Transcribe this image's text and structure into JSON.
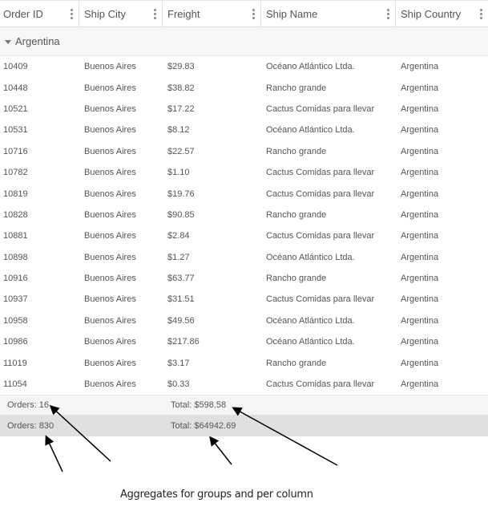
{
  "grid": {
    "columns": [
      {
        "label": "Order ID",
        "menu_icon": "more-vertical-icon"
      },
      {
        "label": "Ship City",
        "menu_icon": "more-vertical-icon"
      },
      {
        "label": "Freight",
        "menu_icon": "more-vertical-icon"
      },
      {
        "label": "Ship Name",
        "menu_icon": "more-vertical-icon"
      },
      {
        "label": "Ship Country",
        "menu_icon": "more-vertical-icon"
      }
    ],
    "group": {
      "label": "Argentina",
      "expand_icon": "caret-down-icon",
      "expanded": true
    },
    "rows": [
      {
        "order_id": "10409",
        "ship_city": "Buenos Aires",
        "freight": "$29.83",
        "ship_name": "Océano Atlántico Ltda.",
        "ship_country": "Argentina"
      },
      {
        "order_id": "10448",
        "ship_city": "Buenos Aires",
        "freight": "$38.82",
        "ship_name": "Rancho grande",
        "ship_country": "Argentina"
      },
      {
        "order_id": "10521",
        "ship_city": "Buenos Aires",
        "freight": "$17.22",
        "ship_name": "Cactus Comidas para llevar",
        "ship_country": "Argentina"
      },
      {
        "order_id": "10531",
        "ship_city": "Buenos Aires",
        "freight": "$8.12",
        "ship_name": "Océano Atlántico Ltda.",
        "ship_country": "Argentina"
      },
      {
        "order_id": "10716",
        "ship_city": "Buenos Aires",
        "freight": "$22.57",
        "ship_name": "Rancho grande",
        "ship_country": "Argentina"
      },
      {
        "order_id": "10782",
        "ship_city": "Buenos Aires",
        "freight": "$1.10",
        "ship_name": "Cactus Comidas para llevar",
        "ship_country": "Argentina"
      },
      {
        "order_id": "10819",
        "ship_city": "Buenos Aires",
        "freight": "$19.76",
        "ship_name": "Cactus Comidas para llevar",
        "ship_country": "Argentina"
      },
      {
        "order_id": "10828",
        "ship_city": "Buenos Aires",
        "freight": "$90.85",
        "ship_name": "Rancho grande",
        "ship_country": "Argentina"
      },
      {
        "order_id": "10881",
        "ship_city": "Buenos Aires",
        "freight": "$2.84",
        "ship_name": "Cactus Comidas para llevar",
        "ship_country": "Argentina"
      },
      {
        "order_id": "10898",
        "ship_city": "Buenos Aires",
        "freight": "$1.27",
        "ship_name": "Océano Atlántico Ltda.",
        "ship_country": "Argentina"
      },
      {
        "order_id": "10916",
        "ship_city": "Buenos Aires",
        "freight": "$63.77",
        "ship_name": "Rancho grande",
        "ship_country": "Argentina"
      },
      {
        "order_id": "10937",
        "ship_city": "Buenos Aires",
        "freight": "$31.51",
        "ship_name": "Cactus Comidas para llevar",
        "ship_country": "Argentina"
      },
      {
        "order_id": "10958",
        "ship_city": "Buenos Aires",
        "freight": "$49.56",
        "ship_name": "Océano Atlántico Ltda.",
        "ship_country": "Argentina"
      },
      {
        "order_id": "10986",
        "ship_city": "Buenos Aires",
        "freight": "$217.86",
        "ship_name": "Océano Atlántico Ltda.",
        "ship_country": "Argentina"
      },
      {
        "order_id": "11019",
        "ship_city": "Buenos Aires",
        "freight": "$3.17",
        "ship_name": "Rancho grande",
        "ship_country": "Argentina"
      },
      {
        "order_id": "11054",
        "ship_city": "Buenos Aires",
        "freight": "$0.33",
        "ship_name": "Cactus Comidas para llevar",
        "ship_country": "Argentina"
      }
    ],
    "group_summary": {
      "orders": "Orders: 16",
      "freight_total": "Total: $598.58"
    },
    "grand_total": {
      "orders": "Orders: 830",
      "freight_total": "Total: $64942.69"
    }
  },
  "annotation": {
    "caption": "Aggregates for groups and per column",
    "arrow_color": "#000000"
  },
  "colors": {
    "group_row_bg": "#f7f7f7",
    "group_summary_bg": "#f5f5f5",
    "grand_total_bg": "#e0e0e0",
    "text": "#555555"
  }
}
